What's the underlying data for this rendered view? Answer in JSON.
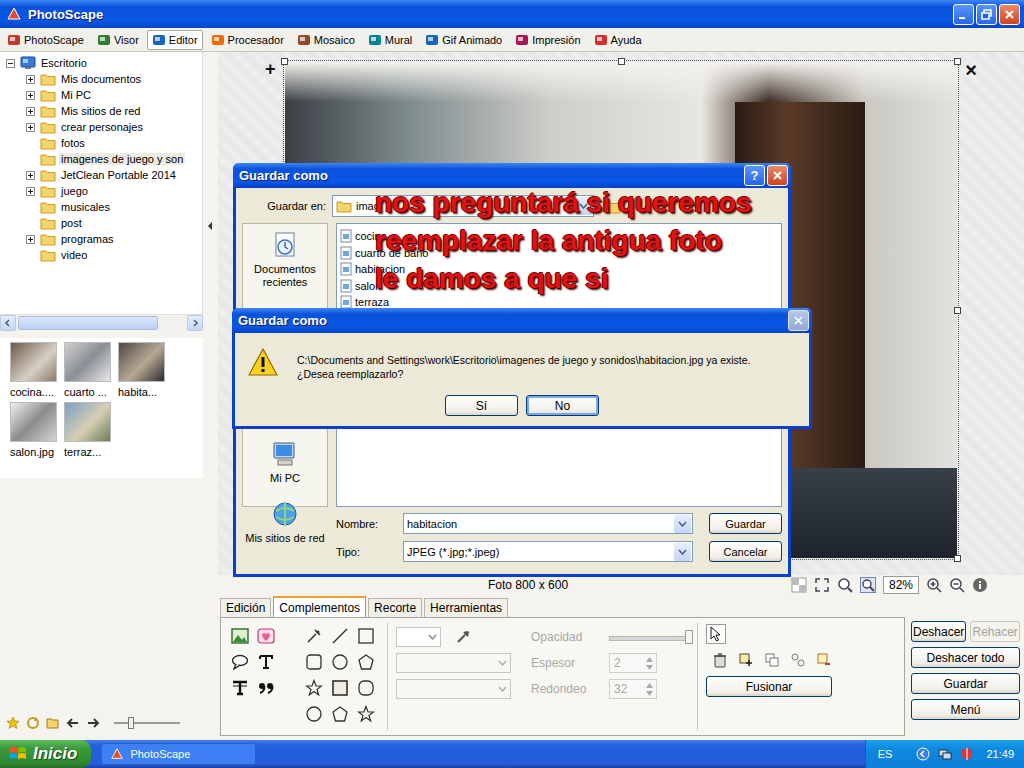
{
  "window": {
    "title": "PhotoScape"
  },
  "tabs": [
    {
      "label": "PhotoScape",
      "selected": false
    },
    {
      "label": "Visor",
      "selected": false
    },
    {
      "label": "Editor",
      "selected": true
    },
    {
      "label": "Procesador",
      "selected": false
    },
    {
      "label": "Mosaico",
      "selected": false
    },
    {
      "label": "Mural",
      "selected": false
    },
    {
      "label": "Gif Animado",
      "selected": false
    },
    {
      "label": "Impresión",
      "selected": false
    },
    {
      "label": "Ayuda",
      "selected": false
    }
  ],
  "folder_tree": {
    "items": [
      {
        "label": "Escritorio",
        "depth": 0,
        "expandable": true,
        "expanded": true,
        "selected": false
      },
      {
        "label": "Mis documentos",
        "depth": 1,
        "expandable": true,
        "expanded": false,
        "selected": false
      },
      {
        "label": "Mi PC",
        "depth": 1,
        "expandable": true,
        "expanded": false,
        "selected": false
      },
      {
        "label": "Mis sitios de red",
        "depth": 1,
        "expandable": true,
        "expanded": false,
        "selected": false
      },
      {
        "label": "crear personajes",
        "depth": 1,
        "expandable": true,
        "expanded": false,
        "selected": false
      },
      {
        "label": "fotos",
        "depth": 1,
        "expandable": false,
        "expanded": false,
        "selected": false
      },
      {
        "label": "imagenes de juego y son",
        "depth": 1,
        "expandable": false,
        "expanded": false,
        "selected": true
      },
      {
        "label": "JetClean Portable 2014",
        "depth": 1,
        "expandable": true,
        "expanded": false,
        "selected": false
      },
      {
        "label": "juego",
        "depth": 1,
        "expandable": true,
        "expanded": false,
        "selected": false
      },
      {
        "label": "musicales",
        "depth": 1,
        "expandable": false,
        "expanded": false,
        "selected": false
      },
      {
        "label": "post",
        "depth": 1,
        "expandable": false,
        "expanded": false,
        "selected": false
      },
      {
        "label": "programas",
        "depth": 1,
        "expandable": true,
        "expanded": false,
        "selected": false
      },
      {
        "label": "video",
        "depth": 1,
        "expandable": false,
        "expanded": false,
        "selected": false
      }
    ]
  },
  "thumbnails": [
    {
      "label": "cocina...."
    },
    {
      "label": "cuarto ..."
    },
    {
      "label": "habita..."
    },
    {
      "label": "salon.jpg"
    },
    {
      "label": "terraz..."
    }
  ],
  "thumbnail_zoom": {
    "level": 0.25
  },
  "canvas": {
    "corner_add": "+",
    "corner_remove": "×",
    "photo_size": "Foto 800 x 600",
    "zoom": "82%"
  },
  "edit_panel": {
    "tabs": [
      {
        "label": "Edición",
        "selected": false
      },
      {
        "label": "Complementos",
        "selected": true
      },
      {
        "label": "Recorte",
        "selected": false
      },
      {
        "label": "Herramientas",
        "selected": false
      }
    ],
    "opacity": {
      "label": "Opacidad",
      "level": 1,
      "disabled": true
    },
    "thickness": {
      "label": "Espesor",
      "value": "2",
      "disabled": true
    },
    "rounding": {
      "label": "Redondeo",
      "value": "32",
      "disabled": true
    },
    "merge_button": "Fusionar"
  },
  "action_buttons": [
    {
      "label": "Deshacer",
      "disabled": false
    },
    {
      "label": "Rehacer",
      "disabled": true
    },
    {
      "label": "Deshacer todo",
      "disabled": false
    },
    {
      "label": "Guardar",
      "disabled": false
    },
    {
      "label": "Menú",
      "disabled": false
    }
  ],
  "save_dialog": {
    "title": "Guardar como",
    "help_button": "?",
    "save_in": {
      "label": "Guardar en:",
      "value": "imag"
    },
    "places": [
      {
        "label": "Documentos recientes"
      },
      {
        "label": "Mi PC"
      },
      {
        "label": "Mis sitios de red"
      }
    ],
    "files": [
      "cocina",
      "cuarto de baño",
      "habitacion",
      "salon",
      "terraza"
    ],
    "name": {
      "label": "Nombre:",
      "value": "habitacion"
    },
    "type": {
      "label": "Tipo:",
      "value": "JPEG (*.jpg;*.jpeg)"
    },
    "buttons": [
      "Guardar",
      "Cancelar"
    ]
  },
  "annotation": {
    "lines": [
      "nos preguntará si queremos",
      "reemplazar la antigua foto",
      "le damos a que si"
    ]
  },
  "confirm_dialog": {
    "title": "Guardar como",
    "close_disabled": true,
    "message": [
      "C:\\Documents and Settings\\work\\Escritorio\\imagenes de juego y sonidos\\habitacion.jpg ya existe.",
      "¿Desea reemplazarlo?"
    ],
    "buttons": [
      {
        "label": "Sí",
        "focused": false
      },
      {
        "label": "No",
        "focused": true
      }
    ]
  },
  "taskbar": {
    "start": "Inicio",
    "tasks": [
      {
        "label": "PhotoScape",
        "selected": false
      }
    ],
    "language": "ES",
    "clock": "21:49"
  }
}
